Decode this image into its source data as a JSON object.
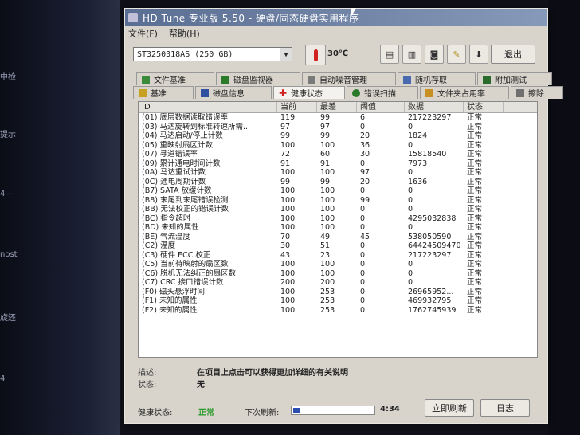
{
  "desktop": {
    "left_texts": [
      "中检",
      "提示",
      "4—",
      "nost",
      "旋还",
      "4"
    ]
  },
  "title": "HD Tune 专业版 5.50 - 硬盘/固态硬盘实用程序",
  "menu": [
    "文件(F)",
    "帮助(H)"
  ],
  "drive": {
    "selected": "ST3250318AS (250 GB)"
  },
  "temperature": "30℃",
  "exit_label": "退出",
  "tabs_row1": [
    {
      "label": "文件基准",
      "icon": "file-benchmark-icon",
      "color": "#3a8a3a"
    },
    {
      "label": "磁盘监视器",
      "icon": "disk-monitor-icon",
      "color": "#2a7a2a"
    },
    {
      "label": "自动噪音管理",
      "icon": "noise-icon",
      "color": "#7a7a7a"
    },
    {
      "label": "随机存取",
      "icon": "random-access-icon",
      "color": "#4a6ab0"
    },
    {
      "label": "附加测试",
      "icon": "extra-tests-icon",
      "color": "#2a6a2a"
    }
  ],
  "tabs_row2": [
    {
      "label": "基准",
      "icon": "benchmark-icon",
      "color": "#c8a020"
    },
    {
      "label": "磁盘信息",
      "icon": "info-icon",
      "color": "#3050a0"
    },
    {
      "label": "健康状态",
      "icon": "health-icon",
      "color": "#d02020"
    },
    {
      "label": "错误扫描",
      "icon": "error-scan-icon",
      "color": "#2a7a2a"
    },
    {
      "label": "文件夹占用率",
      "icon": "folder-icon",
      "color": "#c89020"
    },
    {
      "label": "擦除",
      "icon": "erase-icon",
      "color": "#707070"
    }
  ],
  "table": {
    "headers": [
      "ID",
      "当前",
      "最差",
      "阈值",
      "数据",
      "状态"
    ],
    "rows": [
      [
        "(01) 底层数据读取错误率",
        "119",
        "99",
        "6",
        "217223297",
        "正常"
      ],
      [
        "(03) 马达旋转到标准转速所需...",
        "97",
        "97",
        "0",
        "0",
        "正常"
      ],
      [
        "(04) 马达启动/停止计数",
        "99",
        "99",
        "20",
        "1824",
        "正常"
      ],
      [
        "(05) 重映射扇区计数",
        "100",
        "100",
        "36",
        "0",
        "正常"
      ],
      [
        "(07) 寻道错误率",
        "72",
        "60",
        "30",
        "15818540",
        "正常"
      ],
      [
        "(09) 累计通电时间计数",
        "91",
        "91",
        "0",
        "7973",
        "正常"
      ],
      [
        "(0A) 马达重试计数",
        "100",
        "100",
        "97",
        "0",
        "正常"
      ],
      [
        "(0C) 通电周期计数",
        "99",
        "99",
        "20",
        "1636",
        "正常"
      ],
      [
        "(B7) SATA 放缓计数",
        "100",
        "100",
        "0",
        "0",
        "正常"
      ],
      [
        "(B8) 末尾到末尾错误检测",
        "100",
        "100",
        "99",
        "0",
        "正常"
      ],
      [
        "(BB) 无法校正的错误计数",
        "100",
        "100",
        "0",
        "0",
        "正常"
      ],
      [
        "(BC) 指令超时",
        "100",
        "100",
        "0",
        "4295032838",
        "正常"
      ],
      [
        "(BD) 未知的属性",
        "100",
        "100",
        "0",
        "0",
        "正常"
      ],
      [
        "(BE) 气流温度",
        "70",
        "49",
        "45",
        "538050590",
        "正常"
      ],
      [
        "(C2) 温度",
        "30",
        "51",
        "0",
        "64424509470",
        "正常"
      ],
      [
        "(C3) 硬件 ECC 校正",
        "43",
        "23",
        "0",
        "217223297",
        "正常"
      ],
      [
        "(C5) 当前待映射的扇区数",
        "100",
        "100",
        "0",
        "0",
        "正常"
      ],
      [
        "(C6) 脱机无法纠正的扇区数",
        "100",
        "100",
        "0",
        "0",
        "正常"
      ],
      [
        "(C7) CRC 接口错误计数",
        "200",
        "200",
        "0",
        "0",
        "正常"
      ],
      [
        "(F0) 磁头悬浮时间",
        "100",
        "253",
        "0",
        "26965952...",
        "正常"
      ],
      [
        "(F1) 未知的属性",
        "100",
        "253",
        "0",
        "469932795",
        "正常"
      ],
      [
        "(F2) 未知的属性",
        "100",
        "253",
        "0",
        "1762745939",
        "正常"
      ]
    ]
  },
  "description": {
    "label": "描述:",
    "text": "在项目上点击可以获得更加详细的有关说明"
  },
  "state": {
    "label": "状态:",
    "text": "无"
  },
  "status": {
    "health_label": "健康状态:",
    "health_value": "正常",
    "health_color": "#2a9a2a",
    "refresh_label": "下次刷新:",
    "refresh_progress": 0.08,
    "time": "4:34",
    "refresh_now": "立即刷新",
    "log": "日志"
  }
}
